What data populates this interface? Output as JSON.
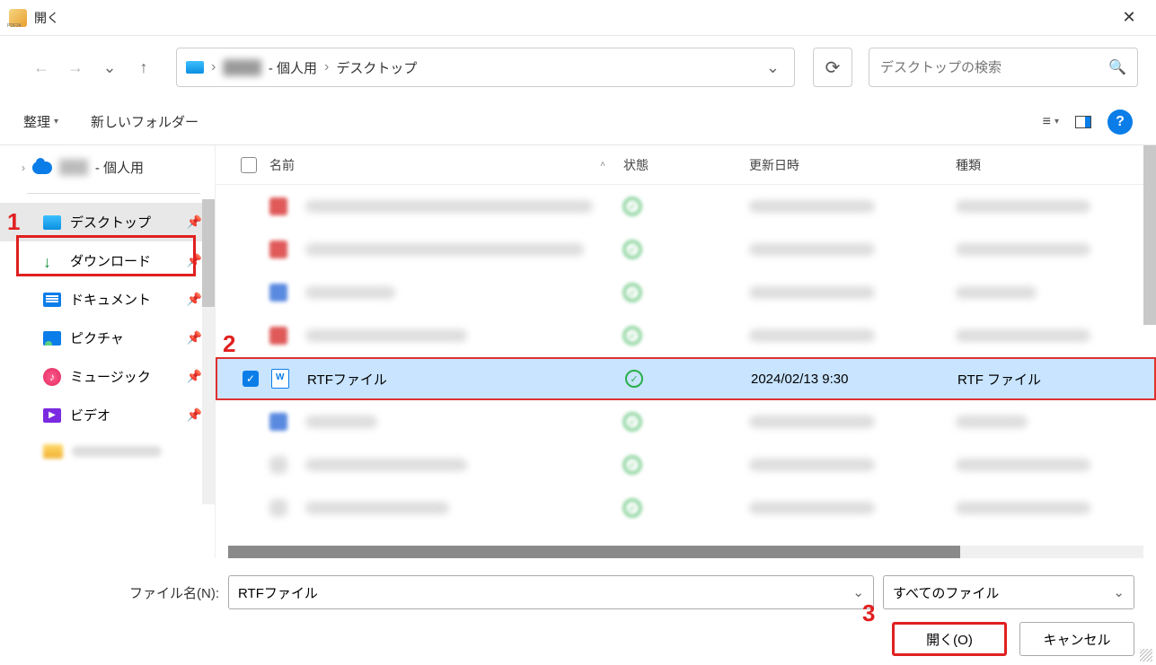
{
  "window": {
    "title": "開く"
  },
  "breadcrumb": {
    "seg1_blur": "████",
    "seg2": "- 個人用",
    "seg3": "デスクトップ"
  },
  "search": {
    "placeholder": "デスクトップの検索"
  },
  "toolbar": {
    "organize": "整理",
    "new_folder": "新しいフォルダー"
  },
  "tree": {
    "root_suffix": "- 個人用",
    "root_blur": "███"
  },
  "quick_access": [
    {
      "label": "デスクトップ",
      "icon": "desktop",
      "selected": true,
      "pinned": true
    },
    {
      "label": "ダウンロード",
      "icon": "download",
      "selected": false,
      "pinned": true
    },
    {
      "label": "ドキュメント",
      "icon": "document",
      "selected": false,
      "pinned": true
    },
    {
      "label": "ピクチャ",
      "icon": "picture",
      "selected": false,
      "pinned": true
    },
    {
      "label": "ミュージック",
      "icon": "music",
      "selected": false,
      "pinned": true
    },
    {
      "label": "ビデオ",
      "icon": "video",
      "selected": false,
      "pinned": true
    }
  ],
  "columns": {
    "name": "名前",
    "status": "状態",
    "date": "更新日時",
    "type": "種類"
  },
  "files": {
    "selected": {
      "name": "RTFファイル",
      "date": "2024/02/13 9:30",
      "type": "RTF ファイル"
    }
  },
  "footer": {
    "filename_label": "ファイル名(N):",
    "filename_value": "RTFファイル",
    "filter": "すべてのファイル",
    "open": "開く(O)",
    "cancel": "キャンセル"
  },
  "annotations": {
    "n1": "1",
    "n2": "2",
    "n3": "3"
  }
}
